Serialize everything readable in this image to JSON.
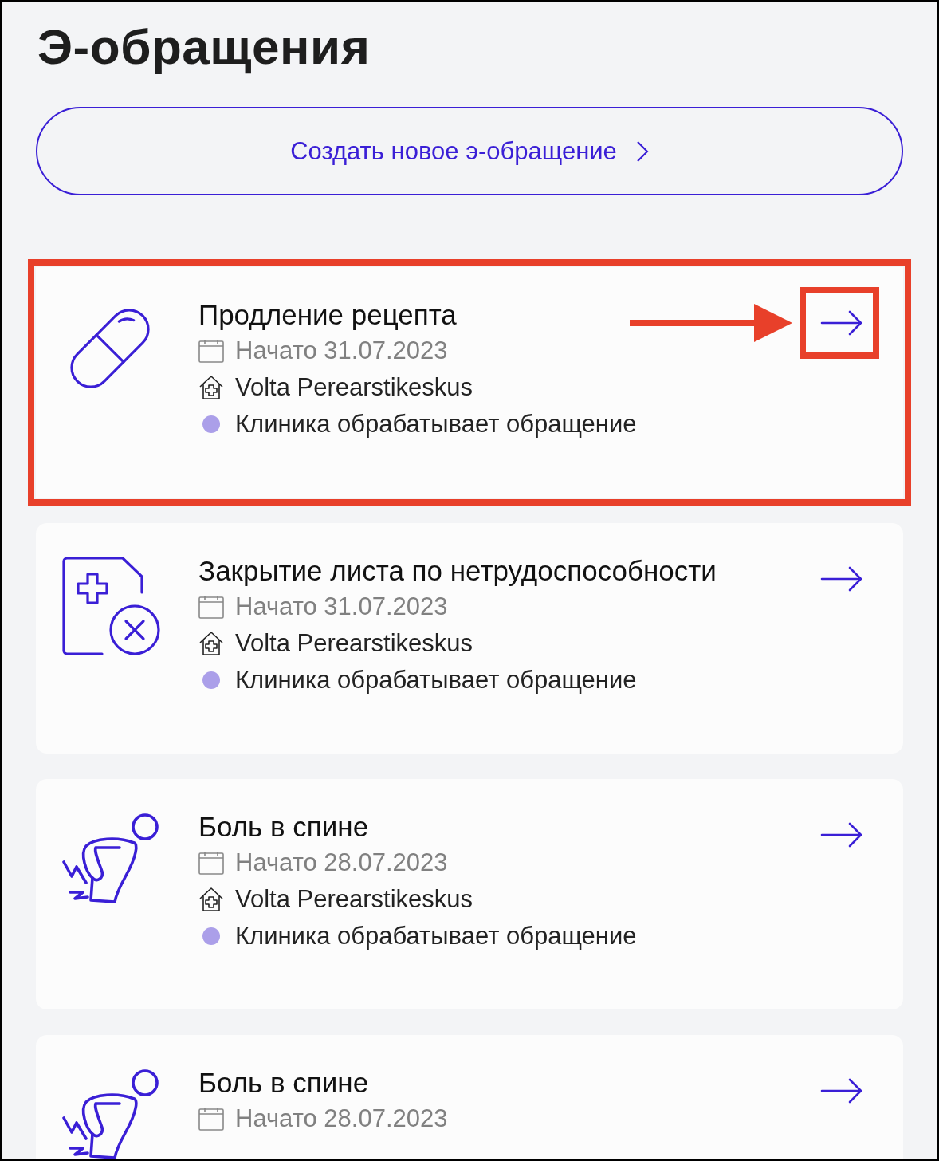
{
  "title": "Э-обращения",
  "create_button": {
    "label": "Создать новое э-обращение"
  },
  "cards": [
    {
      "kind": "pill",
      "title": "Продление рецепта",
      "date": "Начато 31.07.2023",
      "clinic": "Volta Perearstikeskus",
      "status": "Клиника обрабатывает обращение",
      "color": "#ab9fe9",
      "highlighted": true
    },
    {
      "kind": "sick-leave",
      "title": "Закрытие листа по нетрудоспособности",
      "date": "Начато 31.07.2023",
      "clinic": "Volta Perearstikeskus",
      "status": "Клиника обрабатывает обращение",
      "color": "#ab9fe9",
      "highlighted": false
    },
    {
      "kind": "back-pain",
      "title": "Боль в спине",
      "date": "Начато 28.07.2023",
      "clinic": "Volta Perearstikeskus",
      "status": "Клиника обрабатывает обращение",
      "color": "#ab9fe9",
      "highlighted": false
    },
    {
      "kind": "back-pain",
      "title": "Боль в спине",
      "date": "Начато 28.07.2023",
      "highlighted": false
    }
  ]
}
